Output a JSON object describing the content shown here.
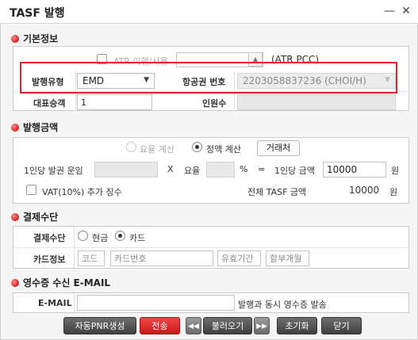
{
  "window": {
    "title": "TASF 발행",
    "minimize_glyph": "—",
    "close_glyph": "✕"
  },
  "basic": {
    "section_title": "기본정보",
    "atr_label": "ATR 이행/사용",
    "atr_note": "(ATR PCC)",
    "issue_type_label": "발행유형",
    "issue_type_value": "EMD",
    "ticket_no_label": "항공권 번호",
    "ticket_no_value": "2203058837236 (CHOI/H)",
    "main_passenger_label": "대표승객",
    "main_passenger_value": "1",
    "headcount_label": "인원수",
    "headcount_value": ""
  },
  "amount": {
    "section_title": "발행금액",
    "radio_rate": "요율 계산",
    "radio_fixed": "정액 계산",
    "vendor_button": "거래처",
    "fare_label": "1인당 발권 운임",
    "multiply": "X",
    "rate_label": "요율",
    "percent": "%",
    "equals": "=",
    "per_person_label": "1인당 금액",
    "per_person_value": "10000",
    "won": "원",
    "vat_label": "VAT(10%) 추가 징수",
    "total_label": "전체 TASF 금액",
    "total_value": "10000",
    "total_unit": "원"
  },
  "payment": {
    "section_title": "결제수단",
    "method_label": "결제수단",
    "cash": "현금",
    "card": "카드",
    "card_info_label": "카드정보",
    "ph_code": "코드",
    "ph_card_no": "카드번호",
    "ph_expiry": "유효기간",
    "ph_installment": "할부개월"
  },
  "receipt": {
    "section_title": "영수증 수신 E-MAIL",
    "email_label": "E-MAIL",
    "email_value": "",
    "email_note": "발행과 동시 영수증 발송"
  },
  "actions": {
    "auto_pnr": "자동PNR생성",
    "send": "전송",
    "prev_glyph": "◀◀",
    "load": "불러오기",
    "next_glyph": "▶▶",
    "reset": "초기화",
    "close": "닫기"
  },
  "colors": {
    "accent_red": "#e0242a",
    "button_dark": "#4a4a4a",
    "section_dot": "#d21f1f"
  }
}
